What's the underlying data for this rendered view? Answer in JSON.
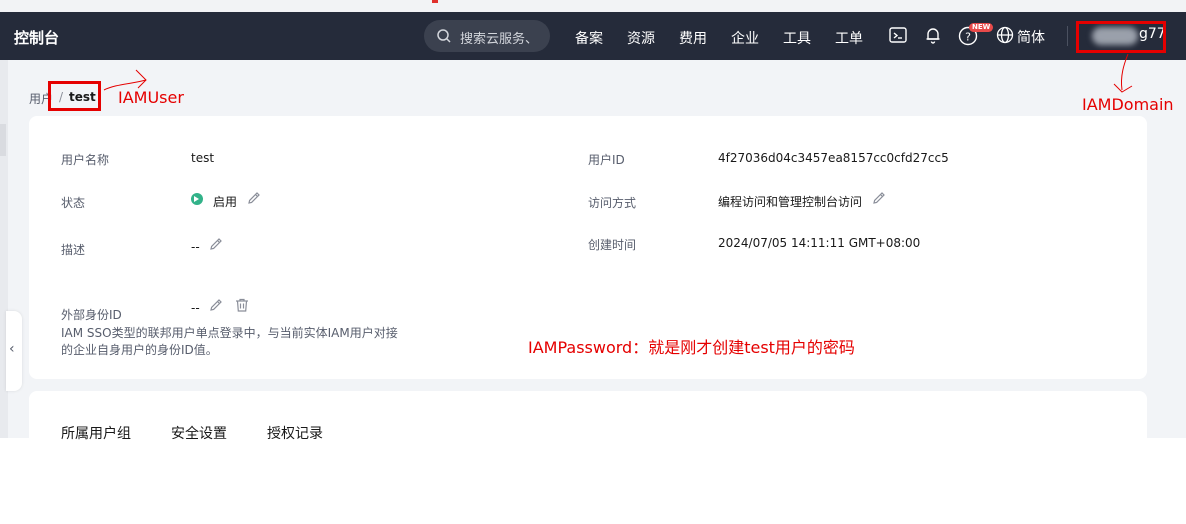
{
  "header": {
    "brand": "控制台",
    "search_placeholder": "搜索云服务、",
    "menu": [
      "备案",
      "资源",
      "费用",
      "企业",
      "工具",
      "工单"
    ],
    "new_badge": "NEW",
    "language": "简体",
    "username_suffix": "g77"
  },
  "breadcrumb": {
    "parent": "用户",
    "separator": "/",
    "current": "test"
  },
  "annotations": {
    "iam_user": "IAMUser",
    "iam_domain": "IAMDomain",
    "iam_password": "IAMPassword：就是刚才创建test用户的密码"
  },
  "details": {
    "username_label": "用户名称",
    "username_value": "test",
    "userid_label": "用户ID",
    "userid_value": "4f27036d04c3457ea8157cc0cfd27cc5",
    "status_label": "状态",
    "status_value": "启用",
    "access_label": "访问方式",
    "access_value": "编程访问和管理控制台访问",
    "desc_label": "描述",
    "desc_value": "--",
    "created_label": "创建时间",
    "created_value": "2024/07/05 14:11:11 GMT+08:00",
    "external_id_label": "外部身份ID",
    "external_id_value": "--",
    "external_id_desc": "IAM SSO类型的联邦用户单点登录中，与当前实体IAM用户对接的企业自身用户的身份ID值。"
  },
  "tabs": [
    "所属用户组",
    "安全设置",
    "授权记录"
  ],
  "colors": {
    "nav_bg": "#252b3a",
    "annotation_red": "#e50000",
    "status_green": "#32b289"
  }
}
